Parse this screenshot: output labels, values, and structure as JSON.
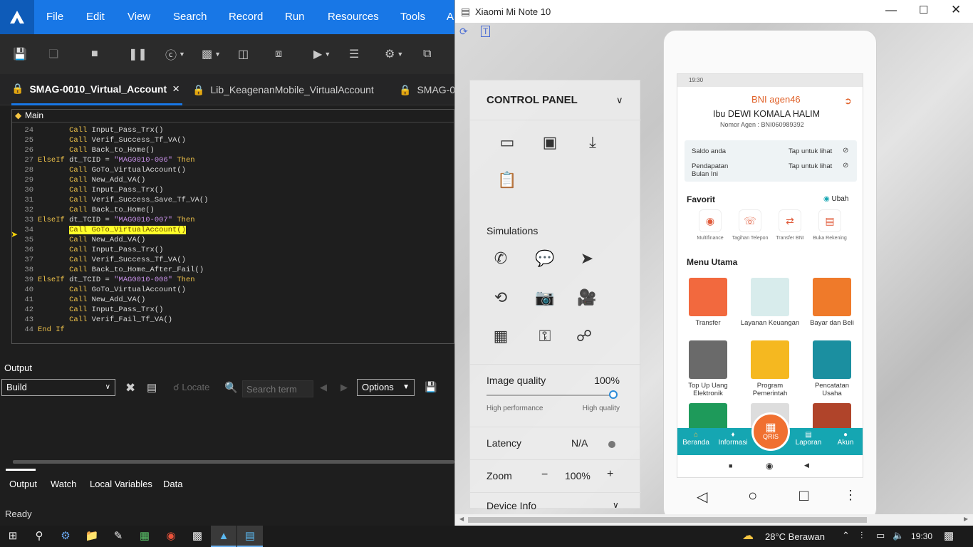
{
  "ide": {
    "menu": [
      "File",
      "Edit",
      "View",
      "Search",
      "Record",
      "Run",
      "Resources",
      "Tools",
      "A"
    ],
    "tabs": [
      {
        "label": "SMAG-0010_Virtual_Account",
        "close": "×"
      },
      {
        "label": "Lib_KeagenanMobile_VirtualAccount"
      },
      {
        "label": "SMAG-0"
      }
    ],
    "breadcrumb": "Main",
    "code": [
      {
        "n": "24",
        "indent": 2,
        "parts": [
          [
            "kw",
            "Call"
          ],
          [
            "id",
            " Input_Pass_Trx()"
          ]
        ]
      },
      {
        "n": "25",
        "indent": 2,
        "parts": [
          [
            "kw",
            "Call"
          ],
          [
            "id",
            " Verif_Success_Tf_VA()"
          ]
        ]
      },
      {
        "n": "26",
        "indent": 2,
        "parts": [
          [
            "kw",
            "Call"
          ],
          [
            "id",
            " Back_to_Home()"
          ]
        ]
      },
      {
        "n": "27",
        "indent": 1,
        "parts": [
          [
            "kw",
            "ElseIf"
          ],
          [
            "id",
            " dt_TCID = "
          ],
          [
            "str",
            "\"MAG0010-006\""
          ],
          [
            "kw",
            " Then"
          ]
        ]
      },
      {
        "n": "28",
        "indent": 2,
        "parts": [
          [
            "kw",
            "Call"
          ],
          [
            "id",
            " GoTo_VirtualAccount()"
          ]
        ]
      },
      {
        "n": "29",
        "indent": 2,
        "parts": [
          [
            "kw",
            "Call"
          ],
          [
            "id",
            " New_Add_VA()"
          ]
        ]
      },
      {
        "n": "30",
        "indent": 2,
        "parts": [
          [
            "kw",
            "Call"
          ],
          [
            "id",
            " Input_Pass_Trx()"
          ]
        ]
      },
      {
        "n": "31",
        "indent": 2,
        "parts": [
          [
            "kw",
            "Call"
          ],
          [
            "id",
            " Verif_Success_Save_Tf_VA()"
          ]
        ]
      },
      {
        "n": "32",
        "indent": 2,
        "parts": [
          [
            "kw",
            "Call"
          ],
          [
            "id",
            " Back_to_Home()"
          ]
        ]
      },
      {
        "n": "33",
        "indent": 1,
        "parts": [
          [
            "kw",
            "ElseIf"
          ],
          [
            "id",
            " dt_TCID = "
          ],
          [
            "str",
            "\"MAG0010-007\""
          ],
          [
            "kw",
            " Then"
          ]
        ]
      },
      {
        "n": "34",
        "indent": 2,
        "parts": [
          [
            "hl",
            "Call GoTo_VirtualAccount()"
          ]
        ]
      },
      {
        "n": "35",
        "indent": 2,
        "parts": [
          [
            "kw",
            "Call"
          ],
          [
            "id",
            " New_Add_VA()"
          ]
        ]
      },
      {
        "n": "36",
        "indent": 2,
        "parts": [
          [
            "kw",
            "Call"
          ],
          [
            "id",
            " Input_Pass_Trx()"
          ]
        ]
      },
      {
        "n": "37",
        "indent": 2,
        "parts": [
          [
            "kw",
            "Call"
          ],
          [
            "id",
            " Verif_Success_Tf_VA()"
          ]
        ]
      },
      {
        "n": "38",
        "indent": 2,
        "parts": [
          [
            "kw",
            "Call"
          ],
          [
            "id",
            " Back_to_Home_After_Fail()"
          ]
        ]
      },
      {
        "n": "39",
        "indent": 1,
        "parts": [
          [
            "kw",
            "ElseIf"
          ],
          [
            "id",
            " dt_TCID = "
          ],
          [
            "str",
            "\"MAG0010-008\""
          ],
          [
            "kw",
            " Then"
          ]
        ]
      },
      {
        "n": "40",
        "indent": 2,
        "parts": [
          [
            "kw",
            "Call"
          ],
          [
            "id",
            " GoTo_VirtualAccount()"
          ]
        ]
      },
      {
        "n": "41",
        "indent": 2,
        "parts": [
          [
            "kw",
            "Call"
          ],
          [
            "id",
            " New_Add_VA()"
          ]
        ]
      },
      {
        "n": "42",
        "indent": 2,
        "parts": [
          [
            "kw",
            "Call"
          ],
          [
            "id",
            " Input_Pass_Trx()"
          ]
        ]
      },
      {
        "n": "43",
        "indent": 2,
        "parts": [
          [
            "kw",
            "Call"
          ],
          [
            "id",
            " Verif_Fail_Tf_VA()"
          ]
        ]
      },
      {
        "n": "44",
        "indent": 1,
        "parts": [
          [
            "kw",
            "End If"
          ]
        ]
      }
    ],
    "output": {
      "title": "Output",
      "build_select": "Build",
      "locate": "Locate",
      "search_placeholder": "Search term",
      "options": "Options"
    },
    "bottom_tabs": [
      "Output",
      "Watch",
      "Local Variables",
      "Data"
    ],
    "status": "Ready"
  },
  "emulator": {
    "title": "Xiaomi Mi Note 10",
    "control_panel": {
      "title": "CONTROL PANEL",
      "simulations": "Simulations",
      "image_quality_label": "Image quality",
      "image_quality_value": "100%",
      "image_quality_fraction": 1.0,
      "high_performance": "High performance",
      "high_quality": "High quality",
      "latency_label": "Latency",
      "latency_value": "N/A",
      "zoom_label": "Zoom",
      "zoom_value": "100%",
      "zoom_minus": "−",
      "zoom_plus": "+",
      "device_info": "Device Info"
    },
    "app": {
      "statusbar": "19:30",
      "brand": "BNI agen46",
      "name": "Ibu DEWI KOMALA HALIM",
      "agent_no": "Nomor Agen : BNI060989392",
      "saldo_label": "Saldo anda",
      "pendapatan_label": "Pendapatan Bulan Ini",
      "tap_hint": "Tap untuk lihat",
      "favorit": "Favorit",
      "ubah": "Ubah",
      "favorites": [
        "Multifinance",
        "Tagihan Telepon",
        "Transfer BNI",
        "Buka Rekening"
      ],
      "menu_title": "Menu Utama",
      "menu": [
        {
          "label": "Transfer",
          "color": "#f2693e"
        },
        {
          "label": "Layanan Keuangan",
          "color": "#d8ecec"
        },
        {
          "label": "Bayar dan Beli",
          "color": "#ef7a2a"
        },
        {
          "label": "Top Up Uang Elektronik",
          "color": "#6a6a6a"
        },
        {
          "label": "Program Pemerintah",
          "color": "#f5b820"
        },
        {
          "label": "Pencatatan Usaha",
          "color": "#1b8fa0"
        }
      ],
      "nav": [
        "Beranda",
        "Informasi",
        "QRIS",
        "Laporan",
        "Akun"
      ]
    }
  },
  "taskbar": {
    "weather": "28°C Berawan",
    "time": "19:30"
  }
}
